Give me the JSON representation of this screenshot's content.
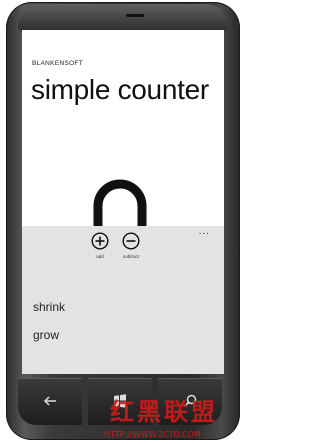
{
  "app": {
    "publisher": "BLANKENSOFT",
    "title": "simple counter"
  },
  "appbar": {
    "ellipsis": "...",
    "buttons": [
      {
        "label": "add",
        "icon": "plus-circle-icon"
      },
      {
        "label": "subtract",
        "icon": "minus-circle-icon"
      }
    ],
    "menu_items": [
      "shrink",
      "grow"
    ]
  },
  "hardware": {
    "buttons": [
      "back-arrow-icon",
      "windows-logo-icon",
      "search-icon"
    ]
  },
  "watermark": {
    "glyphs": "红黑联盟",
    "url": "HTTP://WWW.2CTO.COM"
  },
  "colors": {
    "counter_shape": "#111111",
    "appbar_bg": "#e3e3e3",
    "watermark": "#d11a1a"
  }
}
